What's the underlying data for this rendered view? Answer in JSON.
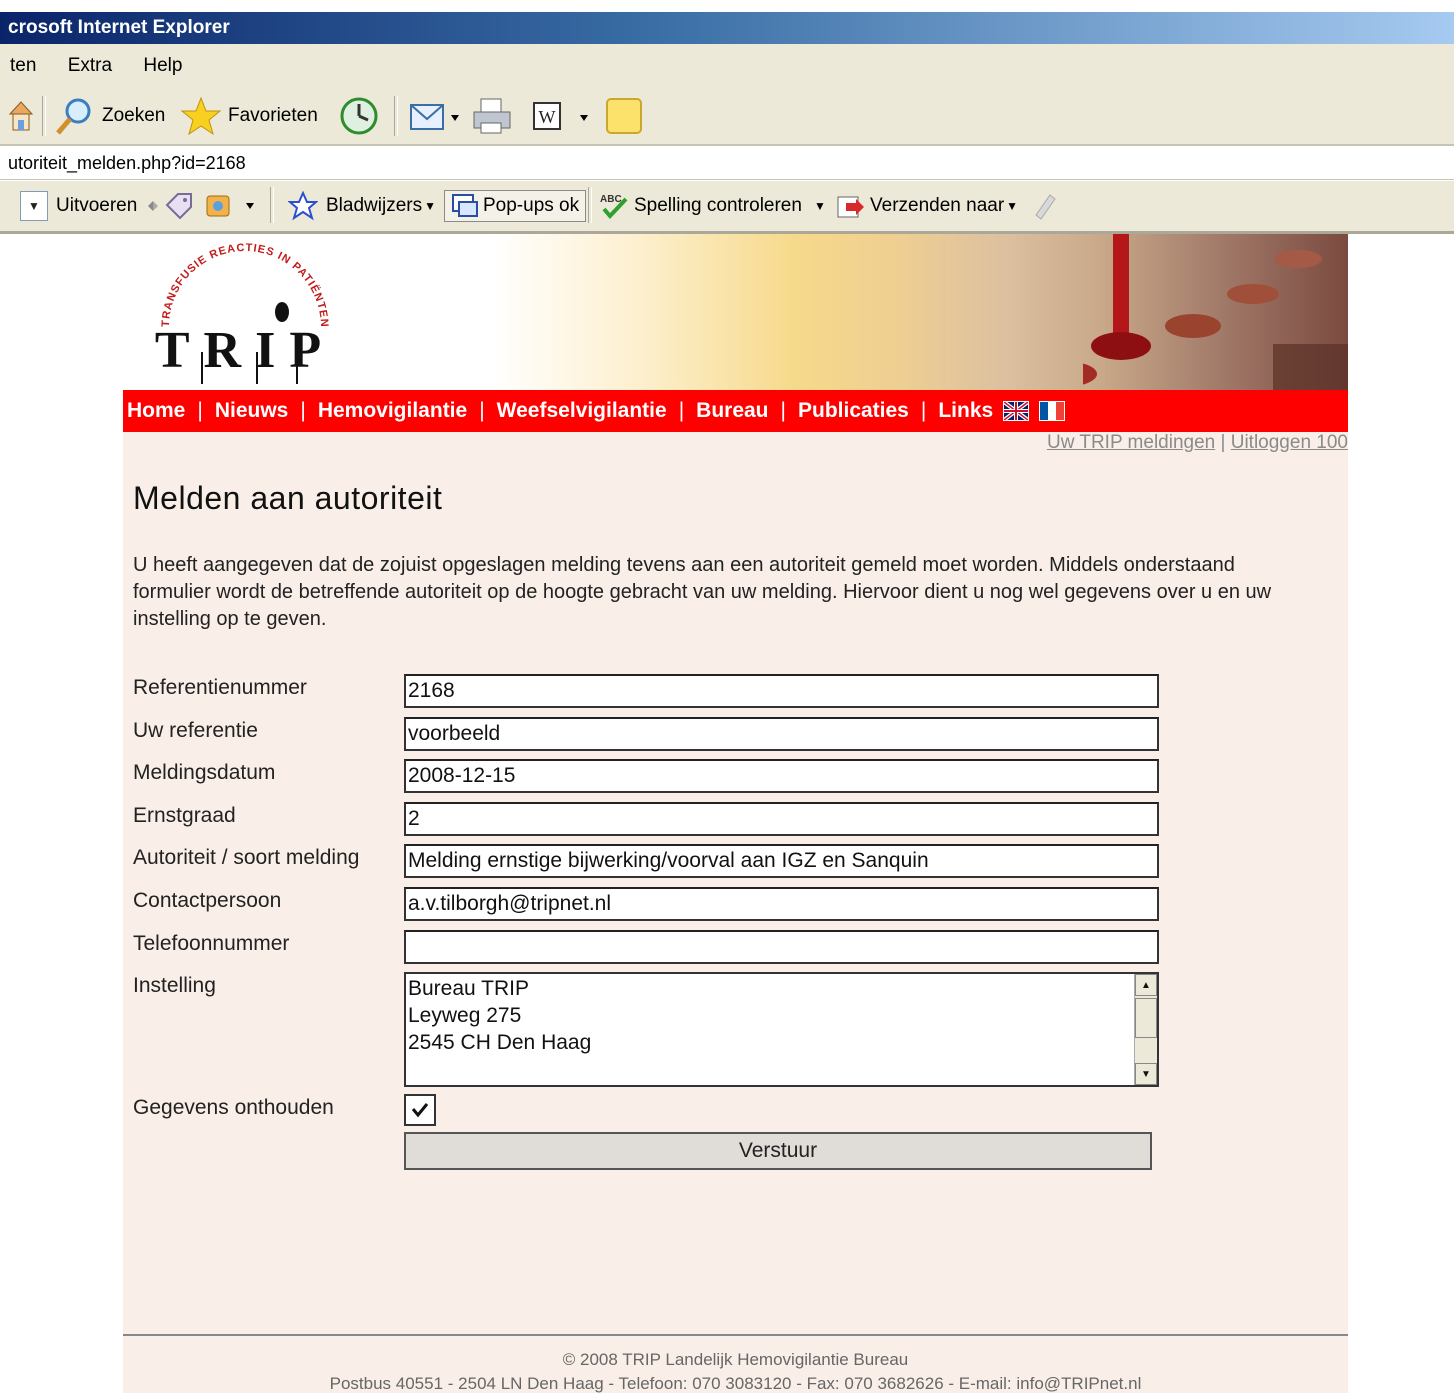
{
  "window": {
    "title": "crosoft Internet Explorer"
  },
  "menu": [
    "ten",
    "Extra",
    "Help"
  ],
  "toolbar": {
    "search": "Zoeken",
    "favorites": "Favorieten"
  },
  "address": "utoriteit_melden.php?id=2168",
  "toolbar2": {
    "run": "Uitvoeren",
    "bookmarks": "Bladwijzers",
    "popups": "Pop-ups ok",
    "spelling": "Spelling controleren",
    "sendto": "Verzenden naar"
  },
  "nav": [
    "Home",
    "Nieuws",
    "Hemovigilantie",
    "Weefselvigilantie",
    "Bureau",
    "Publicaties",
    "Links"
  ],
  "nav_sep": "|",
  "logo": {
    "text": "TRIP",
    "arc_text": "TRANSFUSIE REACTIES IN PATIËNTEN"
  },
  "user_links": {
    "meldingen": "Uw TRIP meldingen",
    "sep": "|",
    "logout": "Uitloggen 100"
  },
  "page": {
    "title": "Melden aan autoriteit",
    "intro": "U heeft aangegeven dat de zojuist opgeslagen melding tevens aan een autoriteit gemeld moet worden. Middels onderstaand formulier wordt de betreffende autoriteit op de hoogte gebracht van uw melding. Hiervoor dient u nog wel gegevens over u en uw instelling op te geven."
  },
  "form": {
    "fields": [
      {
        "label": "Referentienummer",
        "value": "2168"
      },
      {
        "label": "Uw referentie",
        "value": "voorbeeld"
      },
      {
        "label": "Meldingsdatum",
        "value": "2008-12-15"
      },
      {
        "label": "Ernstgraad",
        "value": "2"
      },
      {
        "label": "Autoriteit / soort melding",
        "value": "Melding ernstige bijwerking/voorval aan IGZ en Sanquin"
      },
      {
        "label": "Contactpersoon",
        "value": "a.v.tilborgh@tripnet.nl"
      },
      {
        "label": "Telefoonnummer",
        "value": ""
      }
    ],
    "instelling": {
      "label": "Instelling",
      "lines": [
        "Bureau TRIP",
        "Leyweg 275",
        "2545 CH Den Haag"
      ]
    },
    "remember": {
      "label": "Gegevens onthouden",
      "checked": true
    },
    "submit": "Verstuur"
  },
  "footer": {
    "line1": "© 2008 TRIP Landelijk Hemovigilantie Bureau",
    "line2": "Postbus 40551 - 2504 LN Den Haag - Telefoon: 070 3083120 - Fax: 070 3682626 - E-mail: ",
    "email": "info@TRIPnet.nl"
  },
  "colors": {
    "nav_red": "#ff0000",
    "page_bg": "#f9efe8",
    "chrome": "#ece9d8"
  }
}
